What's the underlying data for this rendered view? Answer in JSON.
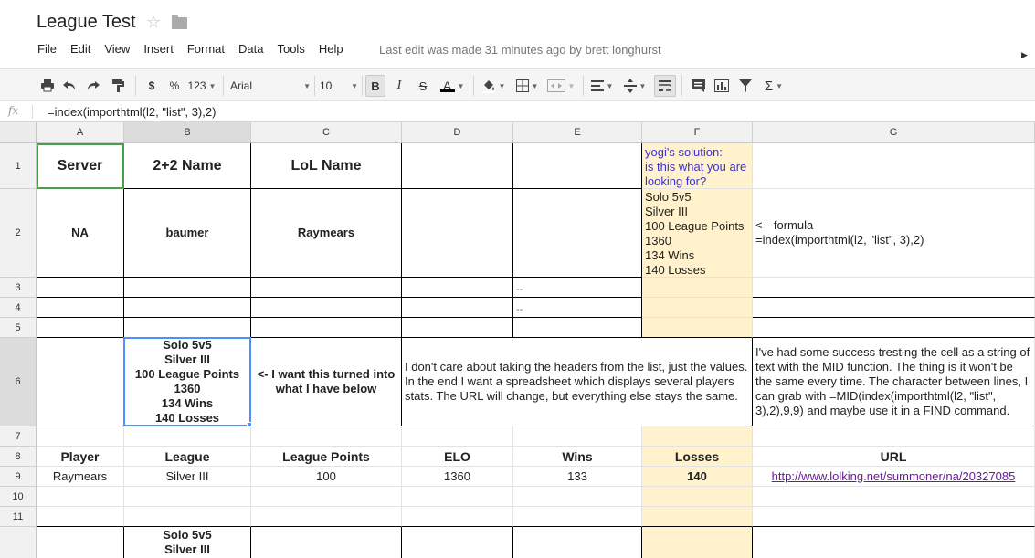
{
  "doc": {
    "title": "League Test",
    "last_edit": "Last edit was made 31 minutes ago by brett longhurst"
  },
  "menu": [
    "File",
    "Edit",
    "View",
    "Insert",
    "Format",
    "Data",
    "Tools",
    "Help"
  ],
  "toolbar": {
    "currency": "$",
    "percent": "%",
    "more_formats": "123",
    "font": "Arial",
    "font_size": "10",
    "bold": "B",
    "italic": "I",
    "strike": "S",
    "text_color": "A",
    "functions": "Σ"
  },
  "formula_bar": {
    "fx_label": "fx",
    "formula": "=index(importhtml(l2, \"list\", 3),2)"
  },
  "columns": [
    "A",
    "B",
    "C",
    "D",
    "E",
    "F",
    "G"
  ],
  "rows": [
    "1",
    "2",
    "3",
    "4",
    "5",
    "6",
    "7",
    "8",
    "9",
    "10",
    "11",
    ""
  ],
  "cells": {
    "A1": "Server",
    "B1": "2+2 Name",
    "C1": "LoL Name",
    "F1": "yogi's solution:\nis this what you are looking for?",
    "A2": "NA",
    "B2": "baumer",
    "C2": "Raymears",
    "F2": "Solo 5v5\nSilver III\n100 League Points\n1360\n134 Wins\n140 Losses",
    "G2": "<-- formula\n=index(importhtml(l2, \"list\", 3),2)",
    "E3": "--",
    "E4": "--",
    "B6": "Solo 5v5\nSilver III\n100 League Points\n1360\n134 Wins\n140 Losses",
    "C6": "<- I want this turned into what I have below",
    "D6": "I don't care about taking the headers from the list, just the values. In the end I want a spreadsheet which displays several players stats. The URL will change, but everything else stays the same.",
    "G6": "I've had some success tresting the cell as a string of text with the MID function. The thing is it won't be the same every time. The character between lines, I can grab with =MID(index(importhtml(l2, \"list\", 3),2),9,9) and maybe use it in a FIND command.",
    "A8": "Player",
    "B8": "League",
    "C8": "League Points",
    "D8": "ELO",
    "E8": "Wins",
    "F8": "Losses",
    "G8": "URL",
    "A9": "Raymears",
    "B9": "Silver III",
    "C9": "100",
    "D9": "1360",
    "E9": "133",
    "F9": "140",
    "G9": "http://www.lolking.net/summoner/na/20327085",
    "B12": "Solo 5v5\nSilver III"
  },
  "colors": {
    "highlight_column": "#fff2cc",
    "link": "#6a1b9a",
    "note_text": "#3c33cc",
    "active_cell_border": "#4d90fe"
  }
}
